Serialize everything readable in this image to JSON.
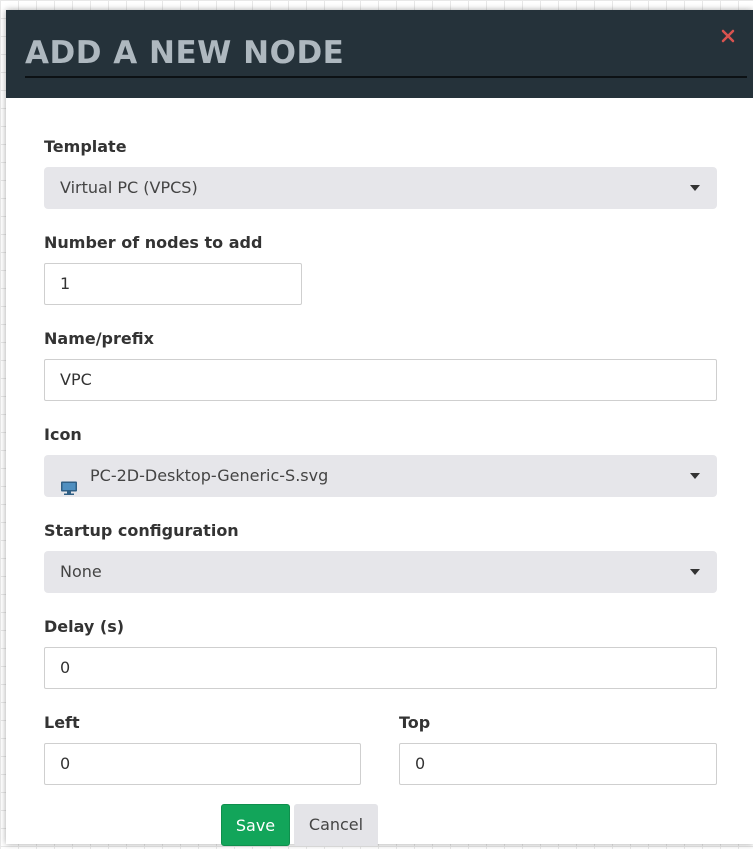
{
  "modal": {
    "title": "ADD A NEW NODE",
    "close_icon": "close-icon"
  },
  "form": {
    "template": {
      "label": "Template",
      "value": "Virtual PC (VPCS)"
    },
    "count": {
      "label": "Number of nodes to add",
      "value": "1"
    },
    "name": {
      "label": "Name/prefix",
      "value": "VPC"
    },
    "icon": {
      "label": "Icon",
      "value": "PC-2D-Desktop-Generic-S.svg",
      "glyph": "desktop-pc-icon"
    },
    "startup": {
      "label": "Startup configuration",
      "value": "None"
    },
    "delay": {
      "label": "Delay (s)",
      "value": "0"
    },
    "left": {
      "label": "Left",
      "value": "0"
    },
    "top": {
      "label": "Top",
      "value": "0"
    }
  },
  "buttons": {
    "save": "Save",
    "cancel": "Cancel"
  },
  "colors": {
    "header_bg": "#25323a",
    "title": "#aeb8bf",
    "close": "#d9534f",
    "save_bg": "#12a55a",
    "select_bg": "#e6e6ea"
  }
}
